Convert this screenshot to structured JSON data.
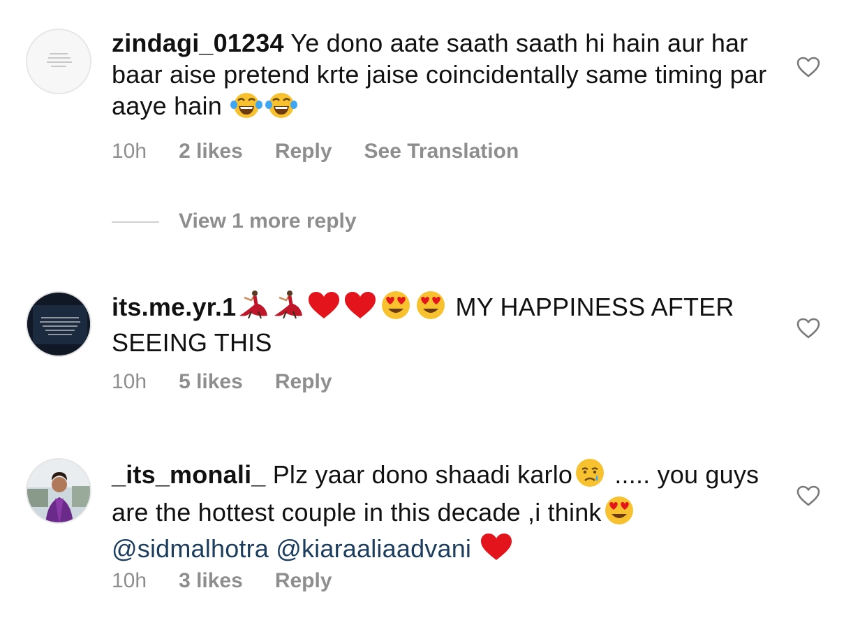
{
  "comments": [
    {
      "username": "zindagi_01234",
      "text_1": " Ye dono aate saath saath hi hain aur har baar aise pretend krte jaise coincidentally same timing par aaye hain ",
      "time": "10h",
      "likes": "2 likes",
      "reply": "Reply",
      "translation": "See Translation",
      "avatar_caption": "\"Where defense stops communication begins.\""
    },
    {
      "username": "its.me.yr.1",
      "text_1": " MY HAPPINESS AFTER SEEING THIS",
      "time": "10h",
      "likes": "5 likes",
      "reply": "Reply",
      "avatar_caption": "DON'T TEACH A GIRL WHAT TO WEAR, WHERE TO GO, HOW TO DRESS UP AND BLAH BLAH BLAH!! TEACH YOUR SON TO RESPECT HER."
    },
    {
      "username": "_its_monali_",
      "text_1": " Plz yaar dono shaadi karlo",
      "text_2": " ..... you guys are the hottest couple in this decade ,i think",
      "mention_1": "@sidmalhotra",
      "mention_2": "@kiaraaliaadvani",
      "time": "10h",
      "likes": "3 likes",
      "reply": "Reply"
    }
  ],
  "view_more": "View 1 more reply",
  "colors": {
    "meta": "#8e8e8e",
    "mention": "#1c3d5e",
    "heart_red": "#e3141b"
  },
  "icons": [
    "heart-outline-icon",
    "laughing-emoji",
    "dancer-emoji",
    "red-heart-emoji",
    "heart-eyes-emoji",
    "crying-emoji"
  ]
}
